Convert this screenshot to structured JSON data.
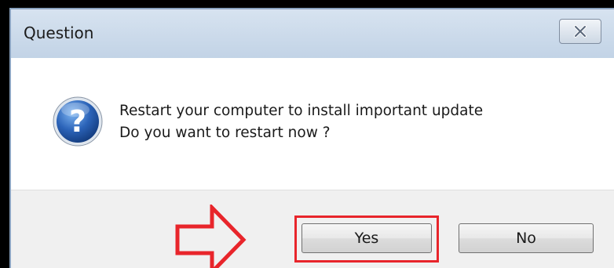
{
  "dialog": {
    "title": "Question",
    "message_line1": "Restart your computer to install important update",
    "message_line2": "Do you want to restart now ?",
    "icon": "question-icon",
    "close_icon": "close-icon"
  },
  "buttons": {
    "yes_label": "Yes",
    "no_label": "No"
  },
  "annotation": {
    "arrow_icon": "arrow-right-icon",
    "highlight_color": "#e8252b"
  },
  "colors": {
    "titlebar": "#c9d7e7",
    "content": "#ffffff",
    "footer": "#f0f0f0",
    "icon_blue": "#1c4fa0"
  }
}
